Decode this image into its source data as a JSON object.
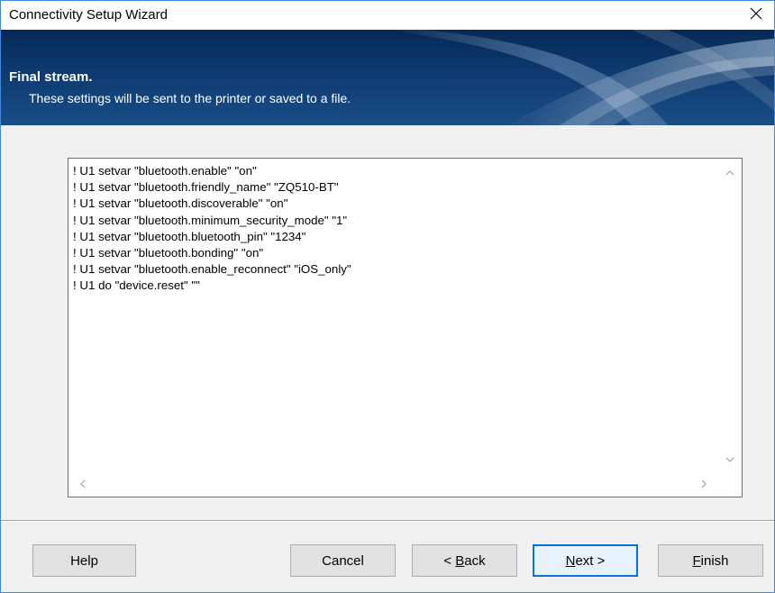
{
  "window": {
    "title": "Connectivity Setup Wizard"
  },
  "banner": {
    "title": "Final stream.",
    "subtitle": "These settings will be sent to the printer or saved to a file."
  },
  "stream": {
    "lines": [
      "! U1 setvar \"bluetooth.enable\" \"on\"",
      "! U1 setvar \"bluetooth.friendly_name\" \"ZQ510-BT\"",
      "! U1 setvar \"bluetooth.discoverable\" \"on\"",
      "! U1 setvar \"bluetooth.minimum_security_mode\" \"1\"",
      "! U1 setvar \"bluetooth.bluetooth_pin\" \"1234\"",
      "! U1 setvar \"bluetooth.bonding\" \"on\"",
      "! U1 setvar \"bluetooth.enable_reconnect\" \"iOS_only\"",
      "! U1 do \"device.reset\" \"\""
    ]
  },
  "buttons": {
    "help": "Help",
    "cancel": "Cancel",
    "back_prefix": "< ",
    "back_mnemonic": "B",
    "back_rest": "ack",
    "next_mnemonic": "N",
    "next_rest": "ext >",
    "finish_mnemonic": "F",
    "finish_rest": "inish"
  },
  "icons": {
    "close": "close-icon",
    "scroll_up": "chevron-up-icon",
    "scroll_down": "chevron-down-icon",
    "scroll_left": "chevron-left-icon",
    "scroll_right": "chevron-right-icon"
  },
  "colors": {
    "accent": "#2b7fd6",
    "banner": "#0d3a70"
  }
}
